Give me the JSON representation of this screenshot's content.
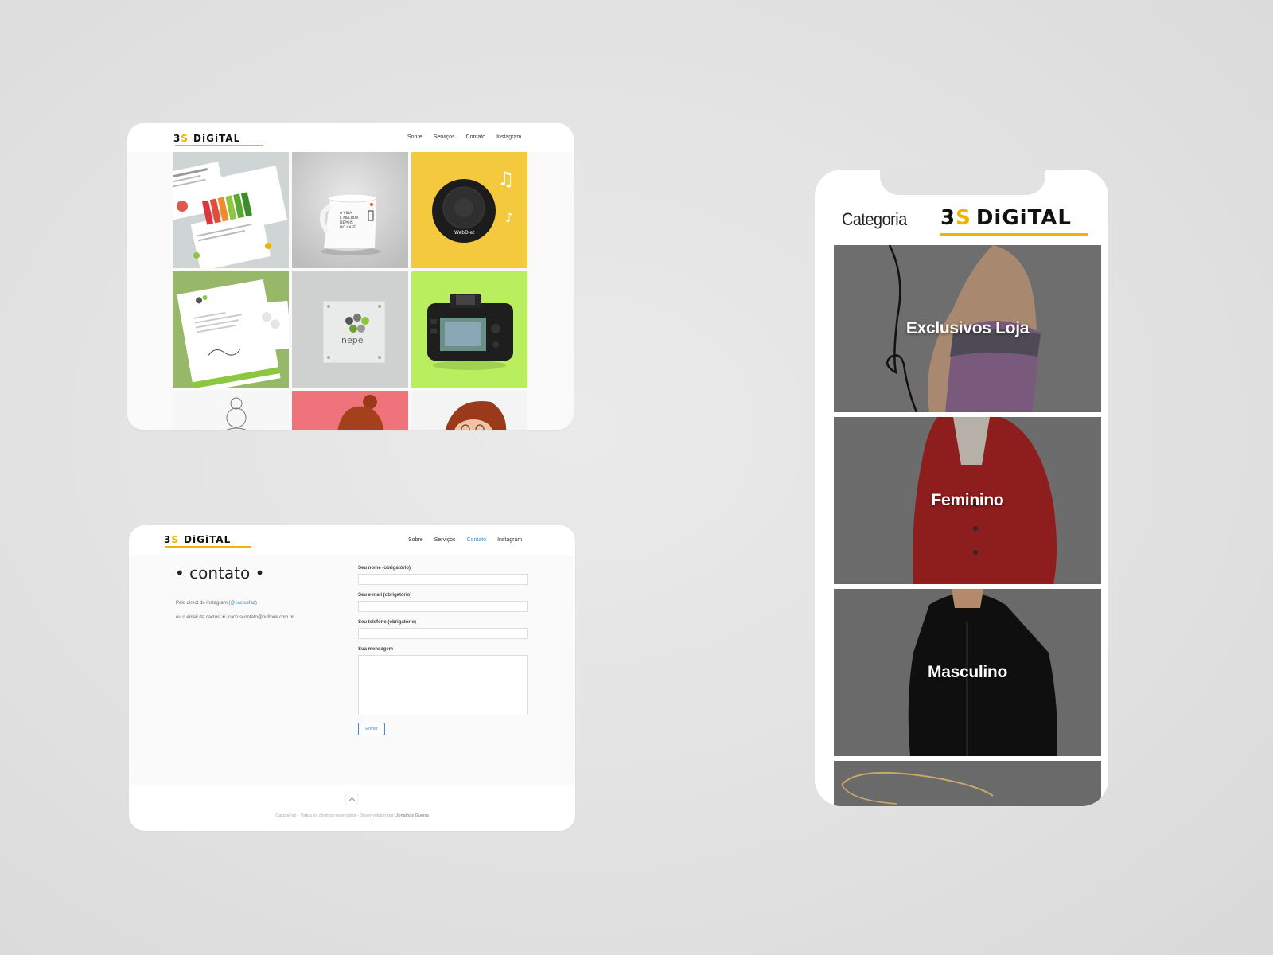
{
  "brand": {
    "prefix": "3",
    "mark": "S",
    "name": "DiGiTAL"
  },
  "nav": {
    "items": [
      "Sobre",
      "Serviços",
      "Contato",
      "Instagram"
    ]
  },
  "portfolio": {
    "mug_text": "A VIDA\nÉ MELHOR\nDEPOIS\nDO CAFÉ.",
    "speaker_brand": "WebDiet",
    "plate_brand": "nepe"
  },
  "contact": {
    "title": "• contato •",
    "line1_prefix": "Pelo direct do instagram (",
    "line1_handle": "@cactusfaz",
    "line1_suffix": ")",
    "line2": "ou o email da cactus 💌 cactuscontato@outlook.com.br",
    "fields": [
      {
        "label": "Seu nome (obrigatório)"
      },
      {
        "label": "Seu e-mail (obrigatório)"
      },
      {
        "label": "Seu telefone (obrigatório)"
      },
      {
        "label": "Sua mensagem"
      }
    ],
    "submit": "Enviar",
    "footer_text": "CactusFaz - Todos os direitos reservados - Desenvolvido por:",
    "footer_author": "Jonathas Guerra"
  },
  "mobile": {
    "header_title": "Categoria",
    "categories": [
      "Exclusivos Loja",
      "Feminino",
      "Masculino"
    ]
  },
  "colors": {
    "accent": "#f1b400",
    "link": "#3b8fd6"
  }
}
